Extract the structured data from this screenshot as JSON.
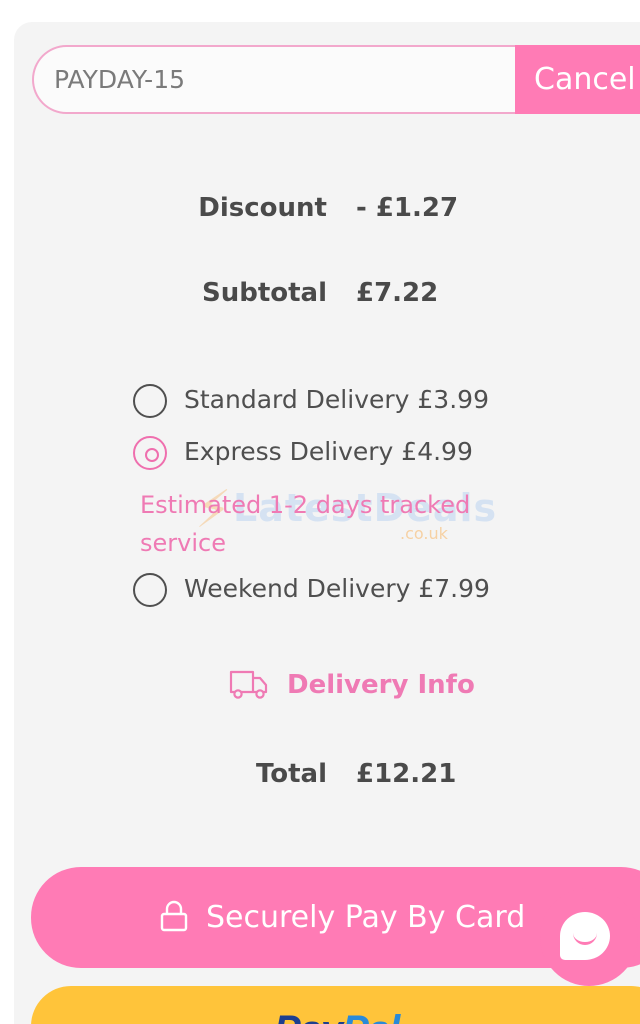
{
  "coupon": {
    "code": "PAYDAY-15",
    "cancel_label": "Cancel"
  },
  "summary": {
    "discount_label": "Discount",
    "discount_value": "- £1.27",
    "subtotal_label": "Subtotal",
    "subtotal_value": "£7.22",
    "total_label": "Total",
    "total_value": "£12.21"
  },
  "delivery": {
    "options": [
      {
        "label": "Standard Delivery £3.99",
        "selected": false
      },
      {
        "label": "Express Delivery £4.99",
        "selected": true
      },
      {
        "label": "Weekend Delivery £7.99",
        "selected": false
      }
    ],
    "express_note": "Estimated 1-2 days tracked service",
    "info_label": "Delivery Info",
    "info_icon": "truck-icon"
  },
  "watermark": {
    "text": "LatestDeals",
    "sub": ".co.uk"
  },
  "payment": {
    "card_label": "Securely Pay By Card",
    "card_icon": "lock-icon",
    "paypal_brand_a": "Pay",
    "paypal_brand_b": "Pal"
  },
  "colors": {
    "accent_pink": "#ff7bb5",
    "text_pink": "#ef7ab4",
    "paypal_yellow": "#ffc43a",
    "panel_bg": "#f4f4f4"
  }
}
